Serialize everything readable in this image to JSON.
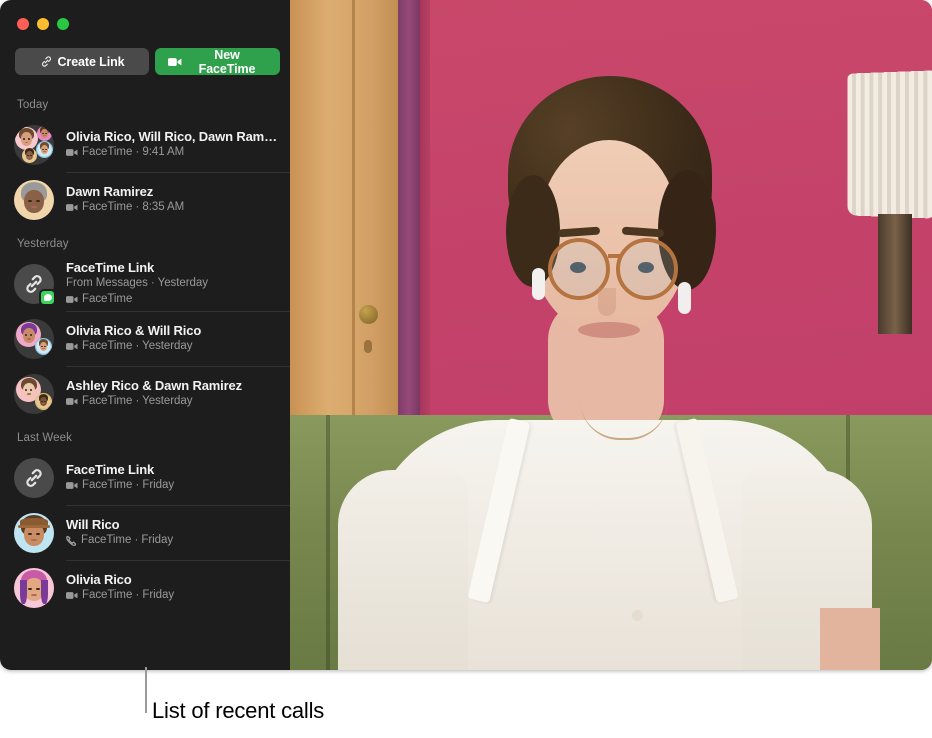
{
  "window": {
    "traffic_lights": [
      {
        "name": "close",
        "color": "#ff5f57"
      },
      {
        "name": "minimize",
        "color": "#febc2e"
      },
      {
        "name": "zoom",
        "color": "#28c840"
      }
    ]
  },
  "toolbar": {
    "create_link_label": "Create Link",
    "create_link_icon": "link-icon",
    "new_facetime_label": "New FaceTime",
    "new_facetime_icon": "video-camera-icon",
    "accent_green": "#2fa04c",
    "button_gray": "#4a4a4a"
  },
  "sidebar": {
    "background": "#1d1d1d",
    "sections": [
      {
        "heading": "Today",
        "rows": [
          {
            "title": "Olivia Rico, Will Rico, Dawn Rami…",
            "subtitle": "FaceTime · 9:41 AM",
            "call_icon": "video-camera-icon",
            "avatar": "group-four-memoji"
          },
          {
            "title": "Dawn Ramirez",
            "subtitle": "FaceTime · 8:35 AM",
            "call_icon": "video-camera-icon",
            "avatar": "memoji-dawn"
          }
        ]
      },
      {
        "heading": "Yesterday",
        "rows": [
          {
            "title": "FaceTime Link",
            "source": "From Messages · Yesterday",
            "subtitle": "FaceTime",
            "call_icon": "video-camera-icon",
            "avatar": "link-icon",
            "badge": "messages-badge"
          },
          {
            "title": "Olivia Rico & Will Rico",
            "subtitle": "FaceTime · Yesterday",
            "call_icon": "video-camera-icon",
            "avatar": "pair-olivia-will"
          },
          {
            "title": "Ashley Rico & Dawn Ramirez",
            "subtitle": "FaceTime · Yesterday",
            "call_icon": "video-camera-icon",
            "avatar": "pair-ashley-dawn"
          }
        ]
      },
      {
        "heading": "Last Week",
        "rows": [
          {
            "title": "FaceTime Link",
            "subtitle": "FaceTime · Friday",
            "call_icon": "video-camera-icon",
            "avatar": "link-icon"
          },
          {
            "title": "Will Rico",
            "subtitle": "FaceTime · Friday",
            "call_icon": "phone-handset-icon",
            "avatar": "memoji-will"
          },
          {
            "title": "Olivia Rico",
            "subtitle": "FaceTime · Friday",
            "call_icon": "video-camera-icon",
            "avatar": "memoji-olivia"
          }
        ]
      }
    ]
  },
  "video": {
    "description": "FaceTime video of a person with short curly dark hair and round tortoiseshell glasses wearing a white short-sleeve blouse over a blue top, seated in front of a pink wall with a wooden door on the left, a lamp on the right and a green sofa behind",
    "wall_color": "#c8486b",
    "door_color": "#d9a066",
    "trim_color": "#8e3f6e",
    "sofa_color": "#7f8f55"
  },
  "caption": {
    "text": "List of recent calls"
  }
}
